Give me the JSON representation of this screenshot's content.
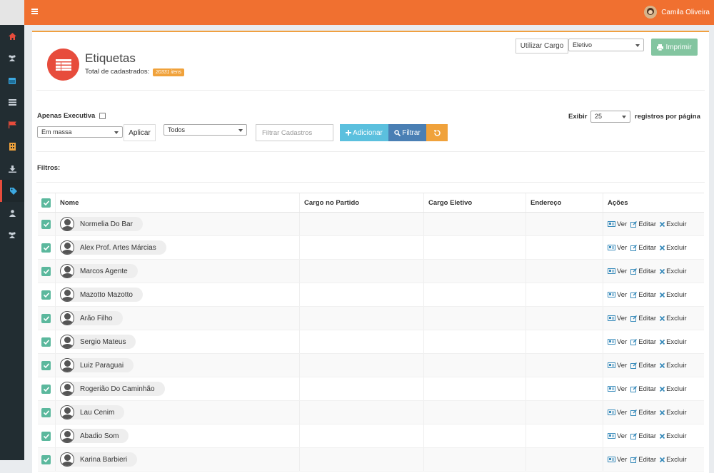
{
  "user": {
    "name": "Camila Oliveira"
  },
  "page": {
    "title": "Etiquetas",
    "total_label": "Total de cadastrados:",
    "total_badge": "20331 itens"
  },
  "header_actions": {
    "usar_cargo": "Utilizar Cargo",
    "cargo_select": "Eletivo",
    "print": "Imprimir"
  },
  "toolbar": {
    "apenas_executiva": "Apenas Executiva",
    "bulk_select": "Em massa",
    "apply": "Aplicar",
    "status_select": "Todos",
    "filter_placeholder": "Filtrar Cadastros",
    "add": "Adicionar",
    "filter": "Filtrar",
    "exibir": "Exibir",
    "page_size": "25",
    "per_page": "registros por página"
  },
  "filters_label": "Filtros:",
  "table": {
    "columns": [
      "Nome",
      "Cargo no Partido",
      "Cargo Eletivo",
      "Endereço",
      "Ações"
    ],
    "action_labels": {
      "view": "Ver",
      "edit": "Editar",
      "delete": "Excluir"
    },
    "rows": [
      "Normelia Do Bar",
      "Alex Prof. Artes Márcias",
      "Marcos Agente",
      "Mazotto Mazotto",
      "Arão Filho",
      "Sergio Mateus",
      "Luiz Paraguai",
      "Rogerião Do Caminhão",
      "Lau Cenim",
      "Abadio Som",
      "Karina Barbieri"
    ]
  },
  "colors": {
    "topbar": "#f07030",
    "sidebar": "#222d32",
    "accent_red": "#e74c3c",
    "check_green": "#5bb89d"
  }
}
